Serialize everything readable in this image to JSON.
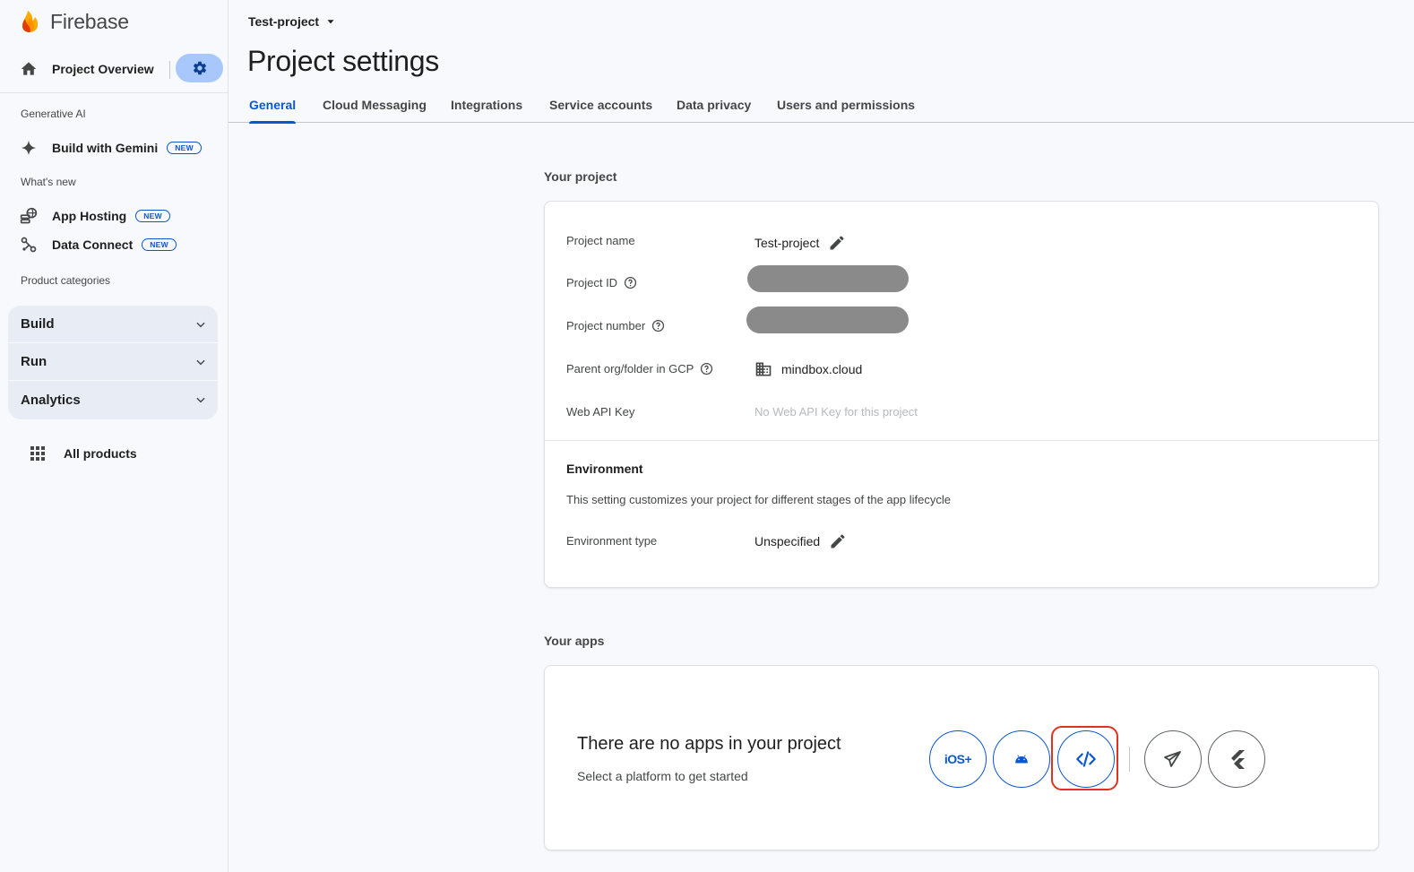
{
  "sidebar": {
    "brand": "Firebase",
    "overview": "Project Overview",
    "sections": {
      "generative_ai": "Generative AI",
      "whats_new": "What's new",
      "product_categories": "Product categories"
    },
    "items": {
      "gemini": "Build with Gemini",
      "app_hosting": "App Hosting",
      "data_connect": "Data Connect"
    },
    "badge": "NEW",
    "categories": [
      "Build",
      "Run",
      "Analytics"
    ],
    "all_products": "All products"
  },
  "header": {
    "project_selector": "Test-project",
    "title": "Project settings"
  },
  "tabs": [
    {
      "label": "General",
      "active": true
    },
    {
      "label": "Cloud Messaging",
      "active": false
    },
    {
      "label": "Integrations",
      "active": false
    },
    {
      "label": "Service accounts",
      "active": false
    },
    {
      "label": "Data privacy",
      "active": false
    },
    {
      "label": "Users and permissions",
      "active": false
    }
  ],
  "your_project": {
    "title": "Your project",
    "fields": {
      "project_name_label": "Project name",
      "project_name_value": "Test-project",
      "project_id_label": "Project ID",
      "project_number_label": "Project number",
      "parent_label": "Parent org/folder in GCP",
      "parent_value": "mindbox.cloud",
      "web_api_label": "Web API Key",
      "web_api_value": "No Web API Key for this project"
    },
    "environment": {
      "title": "Environment",
      "description": "This setting customizes your project for different stages of the app lifecycle",
      "type_label": "Environment type",
      "type_value": "Unspecified"
    }
  },
  "your_apps": {
    "title": "Your apps",
    "empty_title": "There are no apps in your project",
    "empty_subtitle": "Select a platform to get started",
    "platforms": [
      "iOS+",
      "Android",
      "Web",
      "Unity",
      "Flutter"
    ]
  },
  "colors": {
    "accent": "#0b57d0",
    "highlight": "#e0321f",
    "gear_bg": "#a8c7fa",
    "redacted": "#8a8a8a"
  }
}
